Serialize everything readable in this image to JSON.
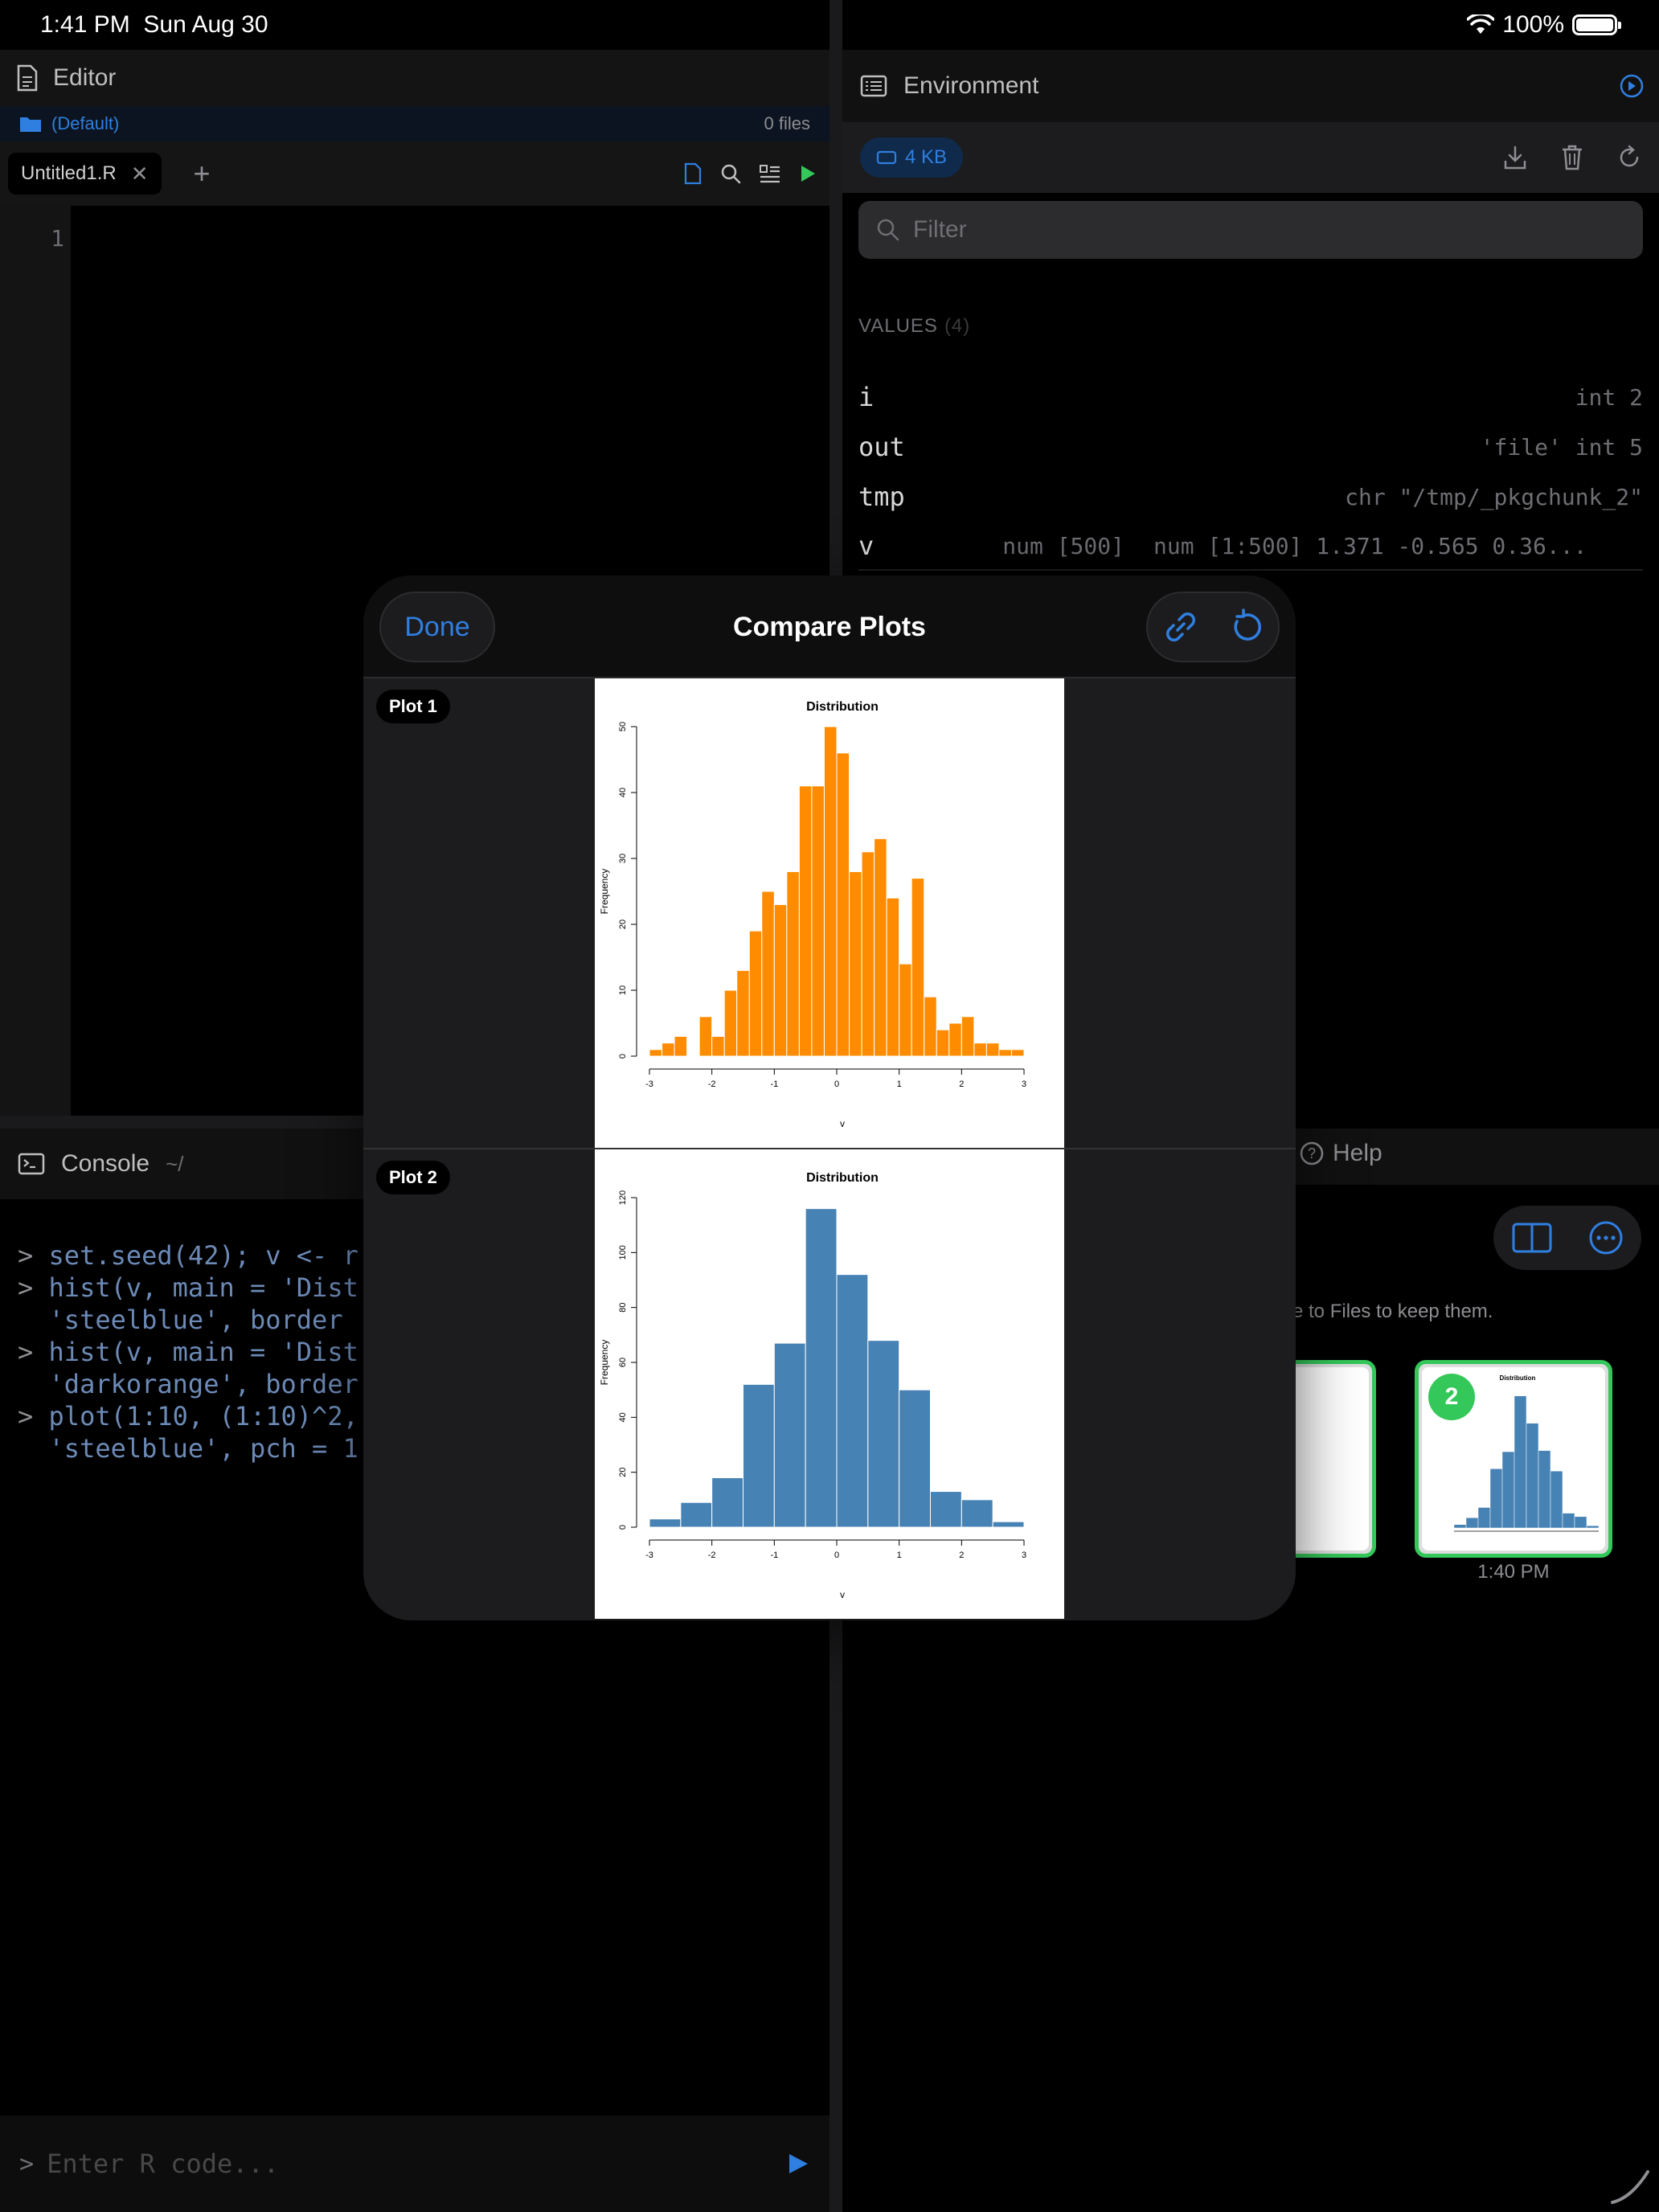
{
  "status": {
    "time": "1:41 PM",
    "date": "Sun Aug 30",
    "battery": "100%"
  },
  "editor": {
    "title": "Editor",
    "project": "(Default)",
    "file_count": "0 files",
    "tab": "Untitled1.R",
    "line_number": "1"
  },
  "environment": {
    "title": "Environment",
    "memory": "4 KB",
    "filter_placeholder": "Filter",
    "values_label": "VALUES",
    "values_count": "(4)",
    "values": [
      {
        "name": "i",
        "summary": "",
        "value": "int 2"
      },
      {
        "name": "out",
        "summary": "",
        "value": "'file' int 5"
      },
      {
        "name": "tmp",
        "summary": "",
        "value": "chr \"/tmp/_pkgchunk_2\""
      },
      {
        "name": "v",
        "summary": "num [500]",
        "value": "num [1:500] 1.371 -0.565 0.36..."
      }
    ]
  },
  "console": {
    "title": "Console",
    "path": "~/",
    "lines": [
      {
        "prompt": ">",
        "text": "set.seed(42); v <- r"
      },
      {
        "prompt": ">",
        "text": "hist(v, main = 'Dist"
      },
      {
        "prompt": "",
        "text": "'steelblue', border "
      },
      {
        "prompt": ">",
        "text": "hist(v, main = 'Dist"
      },
      {
        "prompt": "",
        "text": "'darkorange', border"
      },
      {
        "prompt": ">",
        "text": "plot(1:10, (1:10)^2,"
      },
      {
        "prompt": "",
        "text": "'steelblue', pch = 1"
      }
    ],
    "input_prompt": ">",
    "input_placeholder": "Enter R code..."
  },
  "plots_pane": {
    "help_tab": "Help",
    "save_hint": "e to Files to keep them.",
    "thumb_number": "2",
    "thumb_time": "1:40 PM",
    "thumb_title": "Distribution"
  },
  "modal": {
    "title": "Compare Plots",
    "done": "Done",
    "plot1_label": "Plot 1",
    "plot2_label": "Plot 2"
  },
  "colors": {
    "accent": "#2f7fe0",
    "orange": "#ff8c00",
    "steelblue": "#4682b4",
    "green": "#34c759"
  },
  "chart_data": [
    {
      "type": "bar",
      "title": "Distribution",
      "xlabel": "v",
      "ylabel": "Frequency",
      "color": "#ff8c00",
      "bin_start": -3.0,
      "bin_width": 0.2,
      "values": [
        1,
        2,
        3,
        0,
        6,
        3,
        10,
        13,
        19,
        25,
        23,
        28,
        41,
        41,
        50,
        46,
        28,
        31,
        33,
        24,
        14,
        27,
        9,
        4,
        5,
        6,
        2,
        2,
        1,
        1
      ],
      "xlim": [
        -3,
        3
      ],
      "ylim": [
        0,
        50
      ],
      "xticks": [
        -3,
        -2,
        -1,
        0,
        1,
        2,
        3
      ],
      "yticks": [
        0,
        10,
        20,
        30,
        40,
        50
      ]
    },
    {
      "type": "bar",
      "title": "Distribution",
      "xlabel": "v",
      "ylabel": "Frequency",
      "color": "#4682b4",
      "bin_start": -3.0,
      "bin_width": 0.5,
      "values": [
        3,
        9,
        18,
        52,
        67,
        116,
        92,
        68,
        50,
        13,
        10,
        2
      ],
      "xlim": [
        -3,
        3
      ],
      "ylim": [
        0,
        120
      ],
      "xticks": [
        -3,
        -2,
        -1,
        0,
        1,
        2,
        3
      ],
      "yticks": [
        0,
        20,
        40,
        60,
        80,
        100,
        120
      ]
    }
  ]
}
